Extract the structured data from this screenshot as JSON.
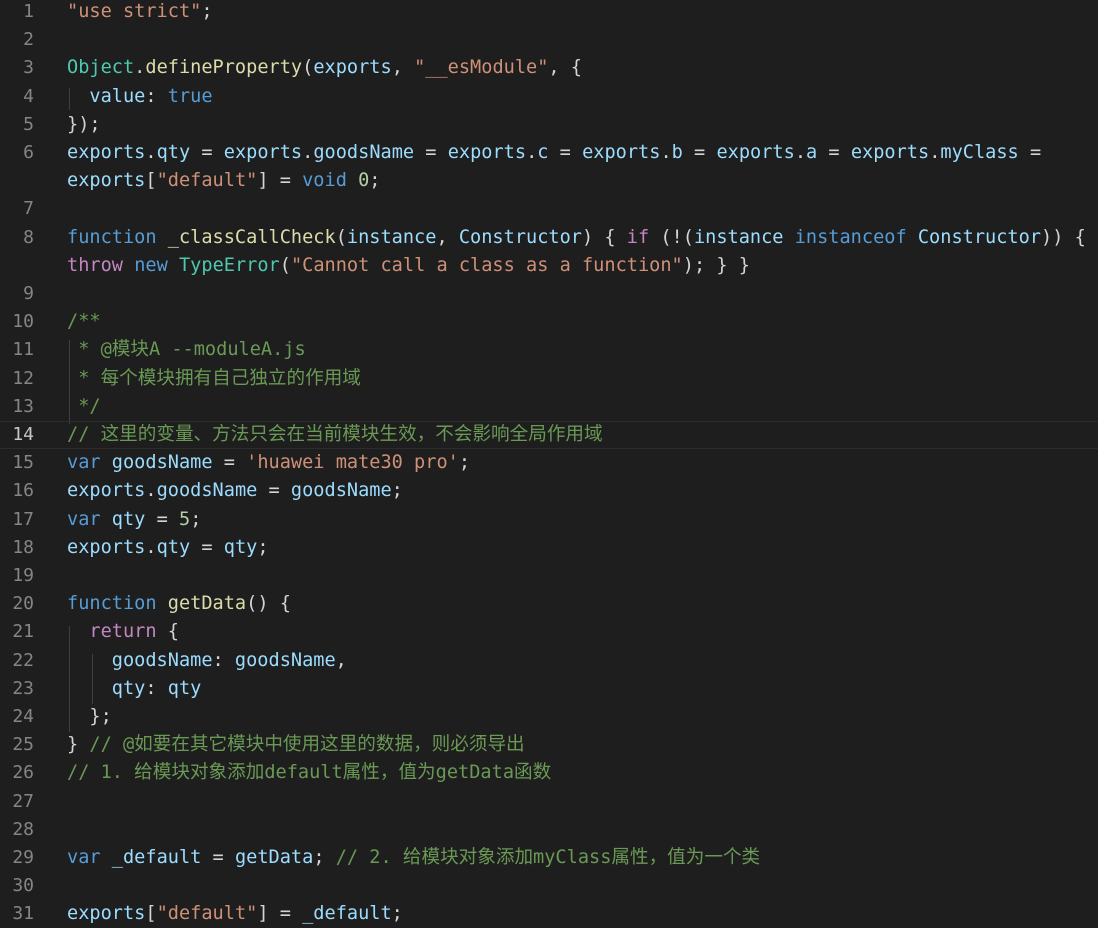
{
  "editor": {
    "language": "javascript",
    "colors": {
      "background": "#1e1e1e",
      "line_number": "#858585",
      "string": "#ce9178",
      "keyword": "#569cd6",
      "control": "#c586c0",
      "variable": "#9cdcfe",
      "function": "#dcdcaa",
      "class": "#4ec9b0",
      "number": "#b5cea8",
      "comment": "#6a9955",
      "plain": "#d4d4d4"
    },
    "lines": [
      {
        "n": "1",
        "tokens": [
          [
            "str",
            "\"use strict\""
          ],
          [
            "pun",
            ";"
          ]
        ]
      },
      {
        "n": "2",
        "tokens": []
      },
      {
        "n": "3",
        "tokens": [
          [
            "cls",
            "Object"
          ],
          [
            "pun",
            "."
          ],
          [
            "fn",
            "defineProperty"
          ],
          [
            "pun",
            "("
          ],
          [
            "var",
            "exports"
          ],
          [
            "pun",
            ", "
          ],
          [
            "str",
            "\"__esModule\""
          ],
          [
            "pun",
            ", {"
          ]
        ]
      },
      {
        "n": "4",
        "tokens": [
          [
            "pun",
            "  "
          ],
          [
            "var",
            "value"
          ],
          [
            "pun",
            ": "
          ],
          [
            "kw",
            "true"
          ]
        ]
      },
      {
        "n": "5",
        "tokens": [
          [
            "pun",
            "});"
          ]
        ]
      },
      {
        "n": "6",
        "tokens": [
          [
            "var",
            "exports"
          ],
          [
            "pun",
            "."
          ],
          [
            "var",
            "qty"
          ],
          [
            "pun",
            " = "
          ],
          [
            "var",
            "exports"
          ],
          [
            "pun",
            "."
          ],
          [
            "var",
            "goodsName"
          ],
          [
            "pun",
            " = "
          ],
          [
            "var",
            "exports"
          ],
          [
            "pun",
            "."
          ],
          [
            "var",
            "c"
          ],
          [
            "pun",
            " = "
          ],
          [
            "var",
            "exports"
          ],
          [
            "pun",
            "."
          ],
          [
            "var",
            "b"
          ],
          [
            "pun",
            " = "
          ],
          [
            "var",
            "exports"
          ],
          [
            "pun",
            "."
          ],
          [
            "var",
            "a"
          ],
          [
            "pun",
            " = "
          ],
          [
            "var",
            "exports"
          ],
          [
            "pun",
            "."
          ],
          [
            "var",
            "myClass"
          ],
          [
            "pun",
            " ="
          ]
        ]
      },
      {
        "n": "",
        "tokens": [
          [
            "var",
            "exports"
          ],
          [
            "pun",
            "["
          ],
          [
            "str",
            "\"default\""
          ],
          [
            "pun",
            "] = "
          ],
          [
            "kw",
            "void"
          ],
          [
            "pun",
            " "
          ],
          [
            "num",
            "0"
          ],
          [
            "pun",
            ";"
          ]
        ]
      },
      {
        "n": "7",
        "tokens": []
      },
      {
        "n": "8",
        "tokens": [
          [
            "kw",
            "function"
          ],
          [
            "pun",
            " "
          ],
          [
            "fn",
            "_classCallCheck"
          ],
          [
            "pun",
            "("
          ],
          [
            "var",
            "instance"
          ],
          [
            "pun",
            ", "
          ],
          [
            "var",
            "Constructor"
          ],
          [
            "pun",
            ") { "
          ],
          [
            "ctl",
            "if"
          ],
          [
            "pun",
            " (!("
          ],
          [
            "var",
            "instance"
          ],
          [
            "pun",
            " "
          ],
          [
            "kw",
            "instanceof"
          ],
          [
            "pun",
            " "
          ],
          [
            "var",
            "Constructor"
          ],
          [
            "pun",
            ")) {"
          ]
        ]
      },
      {
        "n": "",
        "tokens": [
          [
            "ctl",
            "throw"
          ],
          [
            "pun",
            " "
          ],
          [
            "kw",
            "new"
          ],
          [
            "pun",
            " "
          ],
          [
            "cls",
            "TypeError"
          ],
          [
            "pun",
            "("
          ],
          [
            "str",
            "\"Cannot call a class as a function\""
          ],
          [
            "pun",
            "); } }"
          ]
        ]
      },
      {
        "n": "9",
        "tokens": []
      },
      {
        "n": "10",
        "tokens": [
          [
            "cmt",
            "/**"
          ]
        ]
      },
      {
        "n": "11",
        "tokens": [
          [
            "cmt",
            " * @模块A --moduleA.js"
          ]
        ]
      },
      {
        "n": "12",
        "tokens": [
          [
            "cmt",
            " * 每个模块拥有自己独立的作用域"
          ]
        ]
      },
      {
        "n": "13",
        "tokens": [
          [
            "cmt",
            " */"
          ]
        ]
      },
      {
        "n": "14",
        "tokens": [
          [
            "cmt",
            "// 这里的变量、方法只会在当前模块生效，不会影响全局作用域"
          ]
        ]
      },
      {
        "n": "15",
        "tokens": [
          [
            "kw",
            "var"
          ],
          [
            "pun",
            " "
          ],
          [
            "var",
            "goodsName"
          ],
          [
            "pun",
            " = "
          ],
          [
            "str",
            "'huawei mate30 pro'"
          ],
          [
            "pun",
            ";"
          ]
        ]
      },
      {
        "n": "16",
        "tokens": [
          [
            "var",
            "exports"
          ],
          [
            "pun",
            "."
          ],
          [
            "var",
            "goodsName"
          ],
          [
            "pun",
            " = "
          ],
          [
            "var",
            "goodsName"
          ],
          [
            "pun",
            ";"
          ]
        ]
      },
      {
        "n": "17",
        "tokens": [
          [
            "kw",
            "var"
          ],
          [
            "pun",
            " "
          ],
          [
            "var",
            "qty"
          ],
          [
            "pun",
            " = "
          ],
          [
            "num",
            "5"
          ],
          [
            "pun",
            ";"
          ]
        ]
      },
      {
        "n": "18",
        "tokens": [
          [
            "var",
            "exports"
          ],
          [
            "pun",
            "."
          ],
          [
            "var",
            "qty"
          ],
          [
            "pun",
            " = "
          ],
          [
            "var",
            "qty"
          ],
          [
            "pun",
            ";"
          ]
        ]
      },
      {
        "n": "19",
        "tokens": []
      },
      {
        "n": "20",
        "tokens": [
          [
            "kw",
            "function"
          ],
          [
            "pun",
            " "
          ],
          [
            "fn",
            "getData"
          ],
          [
            "pun",
            "() {"
          ]
        ]
      },
      {
        "n": "21",
        "tokens": [
          [
            "pun",
            "  "
          ],
          [
            "ctl",
            "return"
          ],
          [
            "pun",
            " {"
          ]
        ]
      },
      {
        "n": "22",
        "tokens": [
          [
            "pun",
            "    "
          ],
          [
            "var",
            "goodsName"
          ],
          [
            "pun",
            ": "
          ],
          [
            "var",
            "goodsName"
          ],
          [
            "pun",
            ","
          ]
        ]
      },
      {
        "n": "23",
        "tokens": [
          [
            "pun",
            "    "
          ],
          [
            "var",
            "qty"
          ],
          [
            "pun",
            ": "
          ],
          [
            "var",
            "qty"
          ]
        ]
      },
      {
        "n": "24",
        "tokens": [
          [
            "pun",
            "  };"
          ]
        ]
      },
      {
        "n": "25",
        "tokens": [
          [
            "pun",
            "} "
          ],
          [
            "cmt",
            "// @如要在其它模块中使用这里的数据，则必须导出"
          ]
        ]
      },
      {
        "n": "26",
        "tokens": [
          [
            "cmt",
            "// 1. 给模块对象添加default属性，值为getData函数"
          ]
        ]
      },
      {
        "n": "27",
        "tokens": []
      },
      {
        "n": "28",
        "tokens": []
      },
      {
        "n": "29",
        "tokens": [
          [
            "kw",
            "var"
          ],
          [
            "pun",
            " "
          ],
          [
            "var",
            "_default"
          ],
          [
            "pun",
            " = "
          ],
          [
            "var",
            "getData"
          ],
          [
            "pun",
            "; "
          ],
          [
            "cmt",
            "// 2. 给模块对象添加myClass属性，值为一个类"
          ]
        ]
      },
      {
        "n": "30",
        "tokens": []
      },
      {
        "n": "31",
        "tokens": [
          [
            "var",
            "exports"
          ],
          [
            "pun",
            "["
          ],
          [
            "str",
            "\"default\""
          ],
          [
            "pun",
            "] = "
          ],
          [
            "var",
            "_default"
          ],
          [
            "pun",
            ";"
          ]
        ]
      }
    ]
  }
}
